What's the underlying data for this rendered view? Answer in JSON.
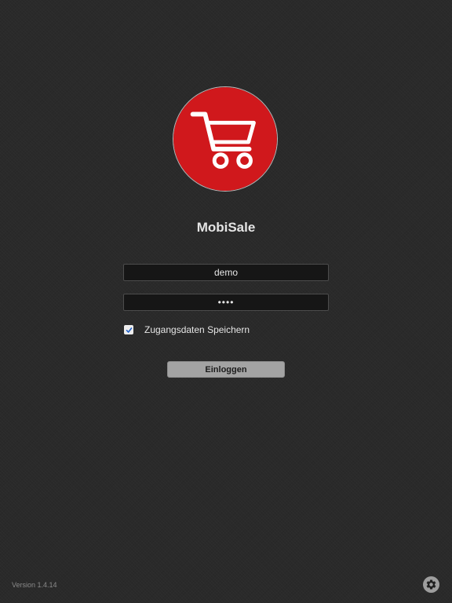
{
  "app": {
    "name": "MobiSale",
    "logo_icon": "shopping-cart-icon",
    "logo_color": "#d0181c"
  },
  "login": {
    "username_value": "demo",
    "password_value": "••••",
    "remember_label": "Zugangsdaten Speichern",
    "remember_checked": true,
    "login_label": "Einloggen"
  },
  "footer": {
    "version": "Version 1.4.14",
    "settings_icon": "gear-icon"
  }
}
